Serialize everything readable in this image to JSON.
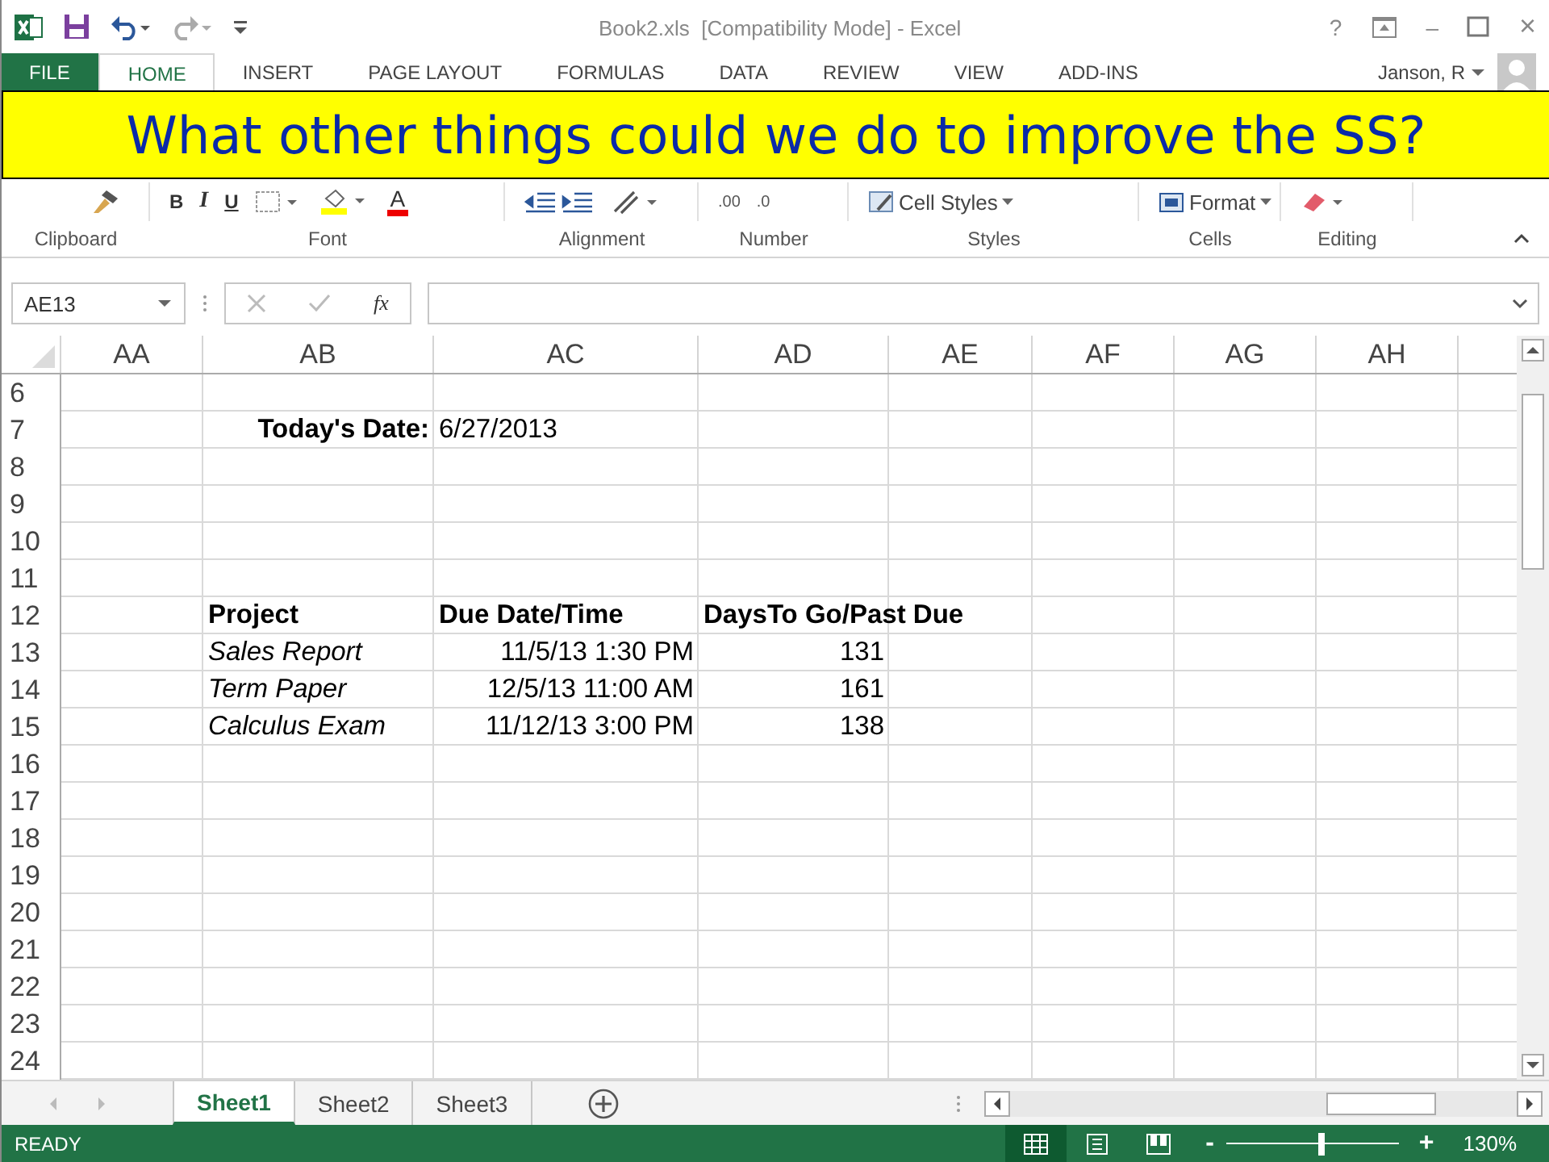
{
  "window": {
    "title": "Book2.xls  [Compatibility Mode] - Excel",
    "controls": [
      "?",
      "–",
      "×"
    ]
  },
  "ribbon_tabs": [
    {
      "label": "FILE",
      "kind": "file",
      "selected": false
    },
    {
      "label": "HOME",
      "kind": "tab",
      "selected": true
    },
    {
      "label": "INSERT",
      "kind": "tab",
      "selected": false
    },
    {
      "label": "PAGE LAYOUT",
      "kind": "tab",
      "selected": false
    },
    {
      "label": "FORMULAS",
      "kind": "tab",
      "selected": false
    },
    {
      "label": "DATA",
      "kind": "tab",
      "selected": false
    },
    {
      "label": "REVIEW",
      "kind": "tab",
      "selected": false
    },
    {
      "label": "VIEW",
      "kind": "tab",
      "selected": false
    },
    {
      "label": "ADD-INS",
      "kind": "tab",
      "selected": false
    }
  ],
  "account": {
    "name": "Janson, R"
  },
  "banner": {
    "text": "What other things could we do to improve the SS?"
  },
  "ribbon": {
    "font_buttons": [
      "B",
      "I",
      "U"
    ],
    "font_color_letter": "A",
    "number_decimals": [
      ".00",
      ".0"
    ],
    "cell_styles": "Cell Styles",
    "format": "Format",
    "groups": [
      "Clipboard",
      "Font",
      "Alignment",
      "Number",
      "Styles",
      "Cells",
      "Editing"
    ]
  },
  "formula_bar": {
    "name_box": "AE13",
    "fx": "fx"
  },
  "columns": [
    "AA",
    "AB",
    "AC",
    "AD",
    "AE",
    "AF",
    "AG",
    "AH"
  ],
  "rows": [
    {
      "number": "6"
    },
    {
      "number": "7",
      "cells": [
        null,
        {
          "text": "Today's Date:",
          "kind": "value",
          "bold": true,
          "italic": false
        },
        {
          "text": "6/27/2013",
          "kind": "text",
          "bold": false,
          "italic": false
        },
        null,
        null,
        null,
        null,
        null
      ]
    },
    {
      "number": "8"
    },
    {
      "number": "9"
    },
    {
      "number": "10"
    },
    {
      "number": "11"
    },
    {
      "number": "12",
      "cells": [
        null,
        {
          "text": "Project",
          "kind": "text",
          "bold": true,
          "italic": false
        },
        {
          "text": "Due Date/Time",
          "kind": "text",
          "bold": true,
          "italic": false
        },
        {
          "text": "DaysTo Go/Past Due",
          "kind": "text",
          "bold": true,
          "italic": false
        },
        null,
        null,
        null,
        null
      ]
    },
    {
      "number": "13",
      "cells": [
        null,
        {
          "text": "Sales Report",
          "kind": "text",
          "bold": false,
          "italic": true
        },
        {
          "text": "11/5/13 1:30 PM",
          "kind": "value",
          "bold": false,
          "italic": false
        },
        {
          "text": "131",
          "kind": "value",
          "bold": false,
          "italic": false
        },
        null,
        null,
        null,
        null
      ]
    },
    {
      "number": "14",
      "cells": [
        null,
        {
          "text": "Term Paper",
          "kind": "text",
          "bold": false,
          "italic": true
        },
        {
          "text": "12/5/13 11:00 AM",
          "kind": "value",
          "bold": false,
          "italic": false
        },
        {
          "text": "161",
          "kind": "value",
          "bold": false,
          "italic": false
        },
        null,
        null,
        null,
        null
      ]
    },
    {
      "number": "15",
      "cells": [
        null,
        {
          "text": "Calculus Exam",
          "kind": "text",
          "bold": false,
          "italic": true
        },
        {
          "text": "11/12/13 3:00 PM",
          "kind": "value",
          "bold": false,
          "italic": false
        },
        {
          "text": "138",
          "kind": "value",
          "bold": false,
          "italic": false
        },
        null,
        null,
        null,
        null
      ]
    },
    {
      "number": "16"
    },
    {
      "number": "17"
    },
    {
      "number": "18"
    },
    {
      "number": "19"
    },
    {
      "number": "20"
    },
    {
      "number": "21"
    },
    {
      "number": "22"
    },
    {
      "number": "23"
    },
    {
      "number": "24"
    }
  ],
  "sheet_tabs": [
    {
      "label": "Sheet1",
      "selected": true
    },
    {
      "label": "Sheet2",
      "selected": false
    },
    {
      "label": "Sheet3",
      "selected": false
    }
  ],
  "status_bar": {
    "text": "READY",
    "views": [
      {
        "selected": true
      },
      {
        "selected": false
      },
      {
        "selected": false
      }
    ],
    "zoom": {
      "level": 0.55,
      "minus": "-",
      "plus": "+",
      "reading": "130%"
    }
  }
}
